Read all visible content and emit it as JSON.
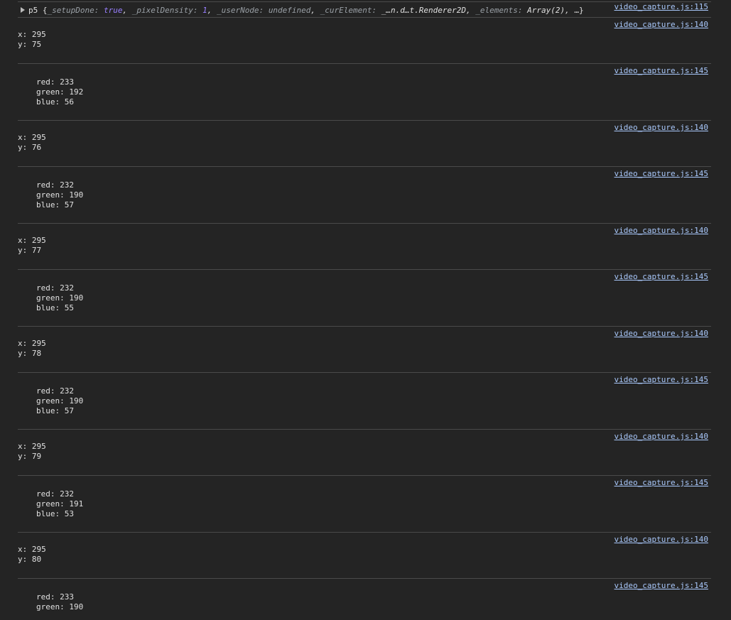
{
  "colors": {
    "background": "#242424",
    "divider": "#4a4a4a",
    "text": "#e0e0e0",
    "link": "#a8c7fa",
    "keyword": "#9980ff"
  },
  "object_log": {
    "source": "video_capture.js:115",
    "prefix": "p5 {",
    "props": [
      {
        "key": "_setupDone",
        "sep": ": ",
        "value": "true",
        "type": "kw",
        "after": ", "
      },
      {
        "key": "_pixelDensity",
        "sep": ": ",
        "value": "1",
        "type": "nm",
        "after": ", "
      },
      {
        "key": "_userNode",
        "sep": ": ",
        "value": "undefined",
        "type": "un",
        "after": ", "
      },
      {
        "key": "_curElement",
        "sep": ": ",
        "value": "_…n.d…t.Renderer2D",
        "type": "pl",
        "after": ", "
      },
      {
        "key": "_elements",
        "sep": ": ",
        "value": "Array(2)",
        "type": "pl",
        "after": ", "
      }
    ],
    "suffix": "…}"
  },
  "messages": [
    {
      "kind": "xy",
      "source": "video_capture.js:140",
      "lines": [
        "x: 295",
        "y: 75"
      ]
    },
    {
      "kind": "rgb",
      "source": "video_capture.js:145",
      "lines": [
        "red: 233",
        "green: 192",
        "blue: 56"
      ]
    },
    {
      "kind": "xy",
      "source": "video_capture.js:140",
      "lines": [
        "x: 295",
        "y: 76"
      ]
    },
    {
      "kind": "rgb",
      "source": "video_capture.js:145",
      "lines": [
        "red: 232",
        "green: 190",
        "blue: 57"
      ]
    },
    {
      "kind": "xy",
      "source": "video_capture.js:140",
      "lines": [
        "x: 295",
        "y: 77"
      ]
    },
    {
      "kind": "rgb",
      "source": "video_capture.js:145",
      "lines": [
        "red: 232",
        "green: 190",
        "blue: 55"
      ]
    },
    {
      "kind": "xy",
      "source": "video_capture.js:140",
      "lines": [
        "x: 295",
        "y: 78"
      ]
    },
    {
      "kind": "rgb",
      "source": "video_capture.js:145",
      "lines": [
        "red: 232",
        "green: 190",
        "blue: 57"
      ]
    },
    {
      "kind": "xy",
      "source": "video_capture.js:140",
      "lines": [
        "x: 295",
        "y: 79"
      ]
    },
    {
      "kind": "rgb",
      "source": "video_capture.js:145",
      "lines": [
        "red: 232",
        "green: 191",
        "blue: 53"
      ]
    },
    {
      "kind": "xy",
      "source": "video_capture.js:140",
      "lines": [
        "x: 295",
        "y: 80"
      ]
    },
    {
      "kind": "rgb",
      "source": "video_capture.js:145",
      "lines": [
        "red: 233",
        "green: 190"
      ]
    }
  ]
}
